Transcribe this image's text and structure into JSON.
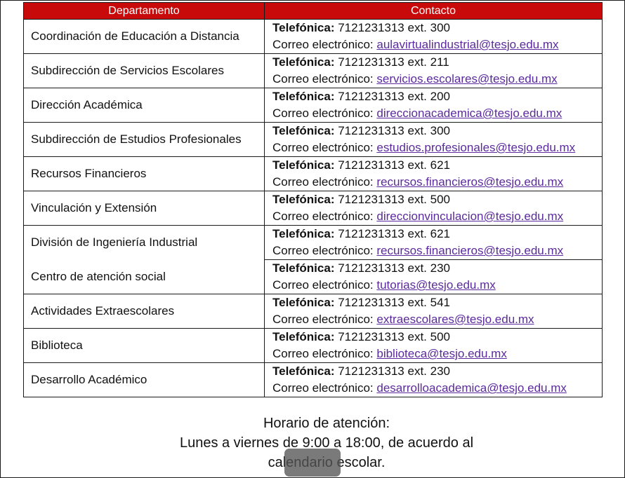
{
  "table": {
    "headers": {
      "department": "Departamento",
      "contact": "Contacto"
    },
    "phone_label": "Telefónica:",
    "email_label": "Correo electrónico:",
    "rows": [
      {
        "department": "Coordinación de Educación a Distancia",
        "phone": "7121231313 ext. 300",
        "email": "aulavirtualindustrial@tesjo.edu.mx"
      },
      {
        "department": "Subdirección de Servicios Escolares",
        "phone": "7121231313 ext. 211",
        "email": "servicios.escolares@tesjo.edu.mx"
      },
      {
        "department": "Dirección Académica",
        "phone": "7121231313 ext. 200",
        "email": "direccionacademica@tesjo.edu.mx"
      },
      {
        "department": "Subdirección de Estudios Profesionales",
        "phone": "7121231313 ext. 300",
        "email": "estudios.profesionales@tesjo.edu.mx"
      },
      {
        "department": "Recursos Financieros",
        "phone": "7121231313 ext. 621",
        "email": "recursos.financieros@tesjo.edu.mx"
      },
      {
        "department": "Vinculación y Extensión",
        "phone": "7121231313 ext. 500",
        "email": "direccionvinculacion@tesjo.edu.mx"
      },
      {
        "department": "División de Ingeniería Industrial",
        "phone": "7121231313 ext. 621",
        "email": "recursos.financieros@tesjo.edu.mx"
      },
      {
        "department": "Centro de atención social",
        "phone": "7121231313 ext. 230",
        "email": "tutorias@tesjo.edu.mx"
      },
      {
        "department": "Actividades Extraescolares",
        "phone": "7121231313 ext. 541",
        "email": "extraescolares@tesjo.edu.mx"
      },
      {
        "department": "Biblioteca",
        "phone": "7121231313 ext. 500",
        "email": "biblioteca@tesjo.edu.mx"
      },
      {
        "department": "Desarrollo Académico",
        "phone": "7121231313 ext. 230",
        "email": "desarrolloacademica@tesjo.edu.mx"
      }
    ]
  },
  "footer": {
    "line1": "Horario de atención:",
    "line2": "Lunes a viernes de 9:00 a 18:00, de acuerdo al",
    "line3": "calendario escolar."
  },
  "colors": {
    "header_bg": "#c80a0a",
    "link": "#5b2a9c"
  }
}
